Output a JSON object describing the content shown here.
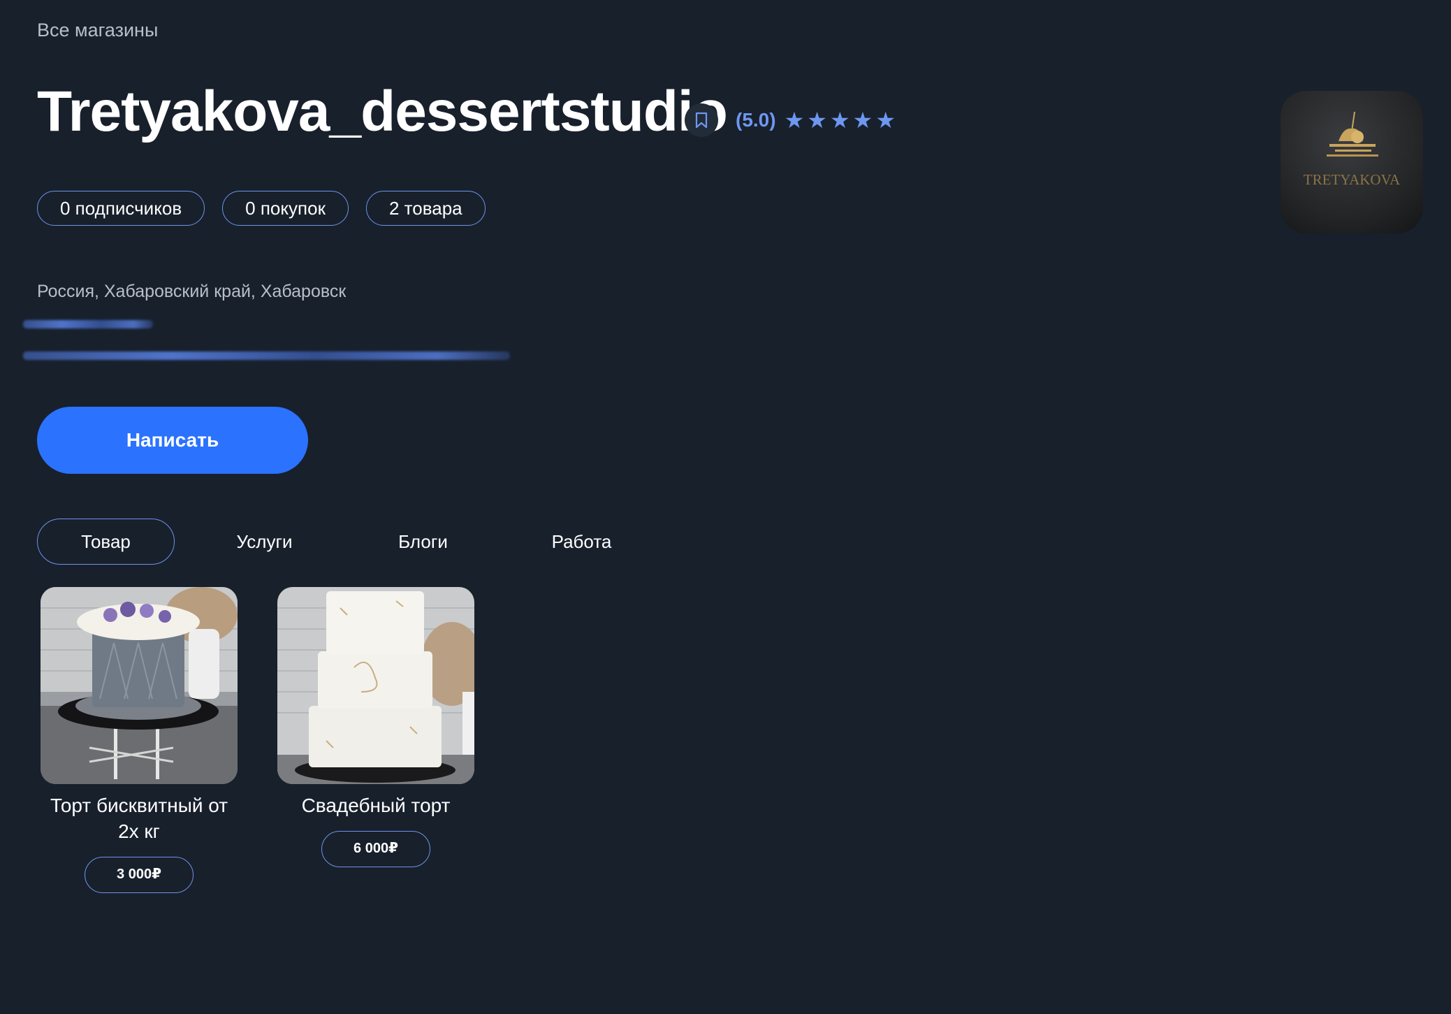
{
  "breadcrumb": "Все магазины",
  "shop": {
    "name": "Tretyakova_dessertstudio",
    "rating_value": "(5.0)",
    "rating_stars": 5,
    "logo_text": "TRETYAKOVA",
    "location": "Россия, Хабаровский край, Хабаровск"
  },
  "stats": [
    "0 подписчиков",
    "0 покупок",
    "2 товара"
  ],
  "write_button": "Написать",
  "tabs": [
    "Товар",
    "Услуги",
    "Блоги",
    "Работа"
  ],
  "active_tab": "Товар",
  "products": [
    {
      "name": "Торт бисквитный от 2х кг",
      "price": "3 000₽"
    },
    {
      "name": "Свадебный торт",
      "price": "6 000₽"
    }
  ],
  "colors": {
    "background": "#18202c",
    "accent": "#2b72ff",
    "outline": "#6e93e8",
    "rating": "#6e97f0"
  },
  "icons": {
    "bookmark": "bookmark-icon",
    "star": "star-icon"
  }
}
